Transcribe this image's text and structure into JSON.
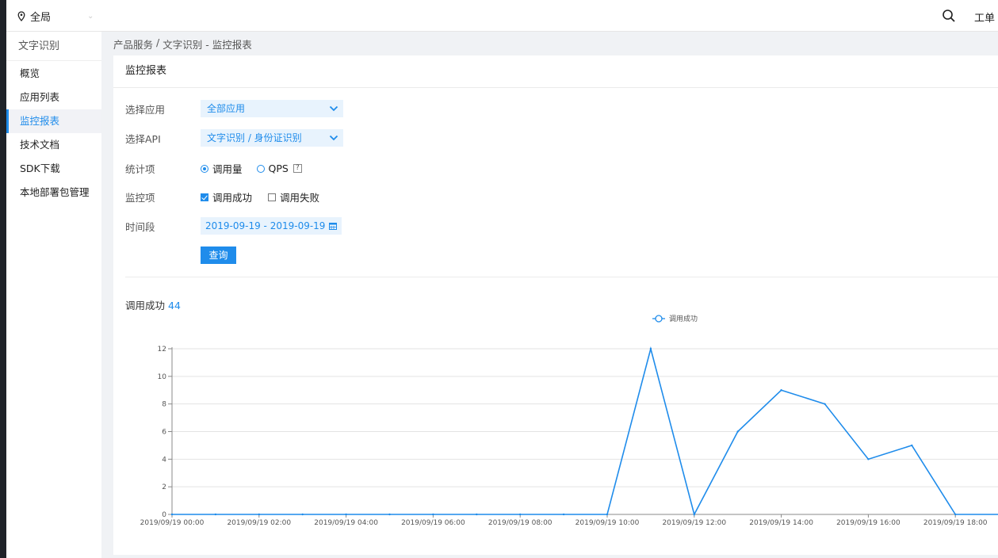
{
  "topbar": {
    "region": "全局",
    "ticket": "工单"
  },
  "sidebar": {
    "title": "文字识别",
    "items": [
      {
        "label": "概览",
        "active": false
      },
      {
        "label": "应用列表",
        "active": false
      },
      {
        "label": "监控报表",
        "active": true
      },
      {
        "label": "技术文档",
        "active": false
      },
      {
        "label": "SDK下载",
        "active": false
      },
      {
        "label": "本地部署包管理",
        "active": false
      }
    ]
  },
  "breadcrumb": {
    "root": "产品服务",
    "sep": "/",
    "current": "文字识别 - 监控报表"
  },
  "panel": {
    "title": "监控报表"
  },
  "form": {
    "app_label": "选择应用",
    "app_value": "全部应用",
    "api_label": "选择API",
    "api_value": "文字识别 / 身份证识别",
    "stat_label": "统计项",
    "stat_opt1": "调用量",
    "stat_opt2": "QPS",
    "qmark": "?",
    "monitor_label": "监控项",
    "monitor_opt1": "调用成功",
    "monitor_opt2": "调用失败",
    "period_label": "时间段",
    "period_value": "2019-09-19 - 2019-09-19",
    "query_label": "查询"
  },
  "metric": {
    "label": "调用成功",
    "count": "44"
  },
  "colors": {
    "accent": "#1f8ceb"
  },
  "chart_data": {
    "type": "line",
    "series": [
      {
        "name": "调用成功",
        "x": [
          "00:00",
          "01:00",
          "02:00",
          "03:00",
          "04:00",
          "05:00",
          "06:00",
          "07:00",
          "08:00",
          "09:00",
          "10:00",
          "11:00",
          "12:00",
          "13:00",
          "14:00",
          "15:00",
          "16:00",
          "17:00",
          "18:00",
          "19:00"
        ],
        "values": [
          0,
          0,
          0,
          0,
          0,
          0,
          0,
          0,
          0,
          0,
          0,
          12,
          0,
          6,
          9,
          8,
          4,
          5,
          0,
          0
        ]
      }
    ],
    "x_tick_labels": [
      "2019/09/19 00:00",
      "2019/09/19 02:00",
      "2019/09/19 04:00",
      "2019/09/19 06:00",
      "2019/09/19 08:00",
      "2019/09/19 10:00",
      "2019/09/19 12:00",
      "2019/09/19 14:00",
      "2019/09/19 16:00",
      "2019/09/19 18:00"
    ],
    "y_ticks": [
      0,
      2,
      4,
      6,
      8,
      10,
      12
    ],
    "ylim": [
      0,
      12
    ],
    "grid": true,
    "legend_position": "top-center"
  }
}
